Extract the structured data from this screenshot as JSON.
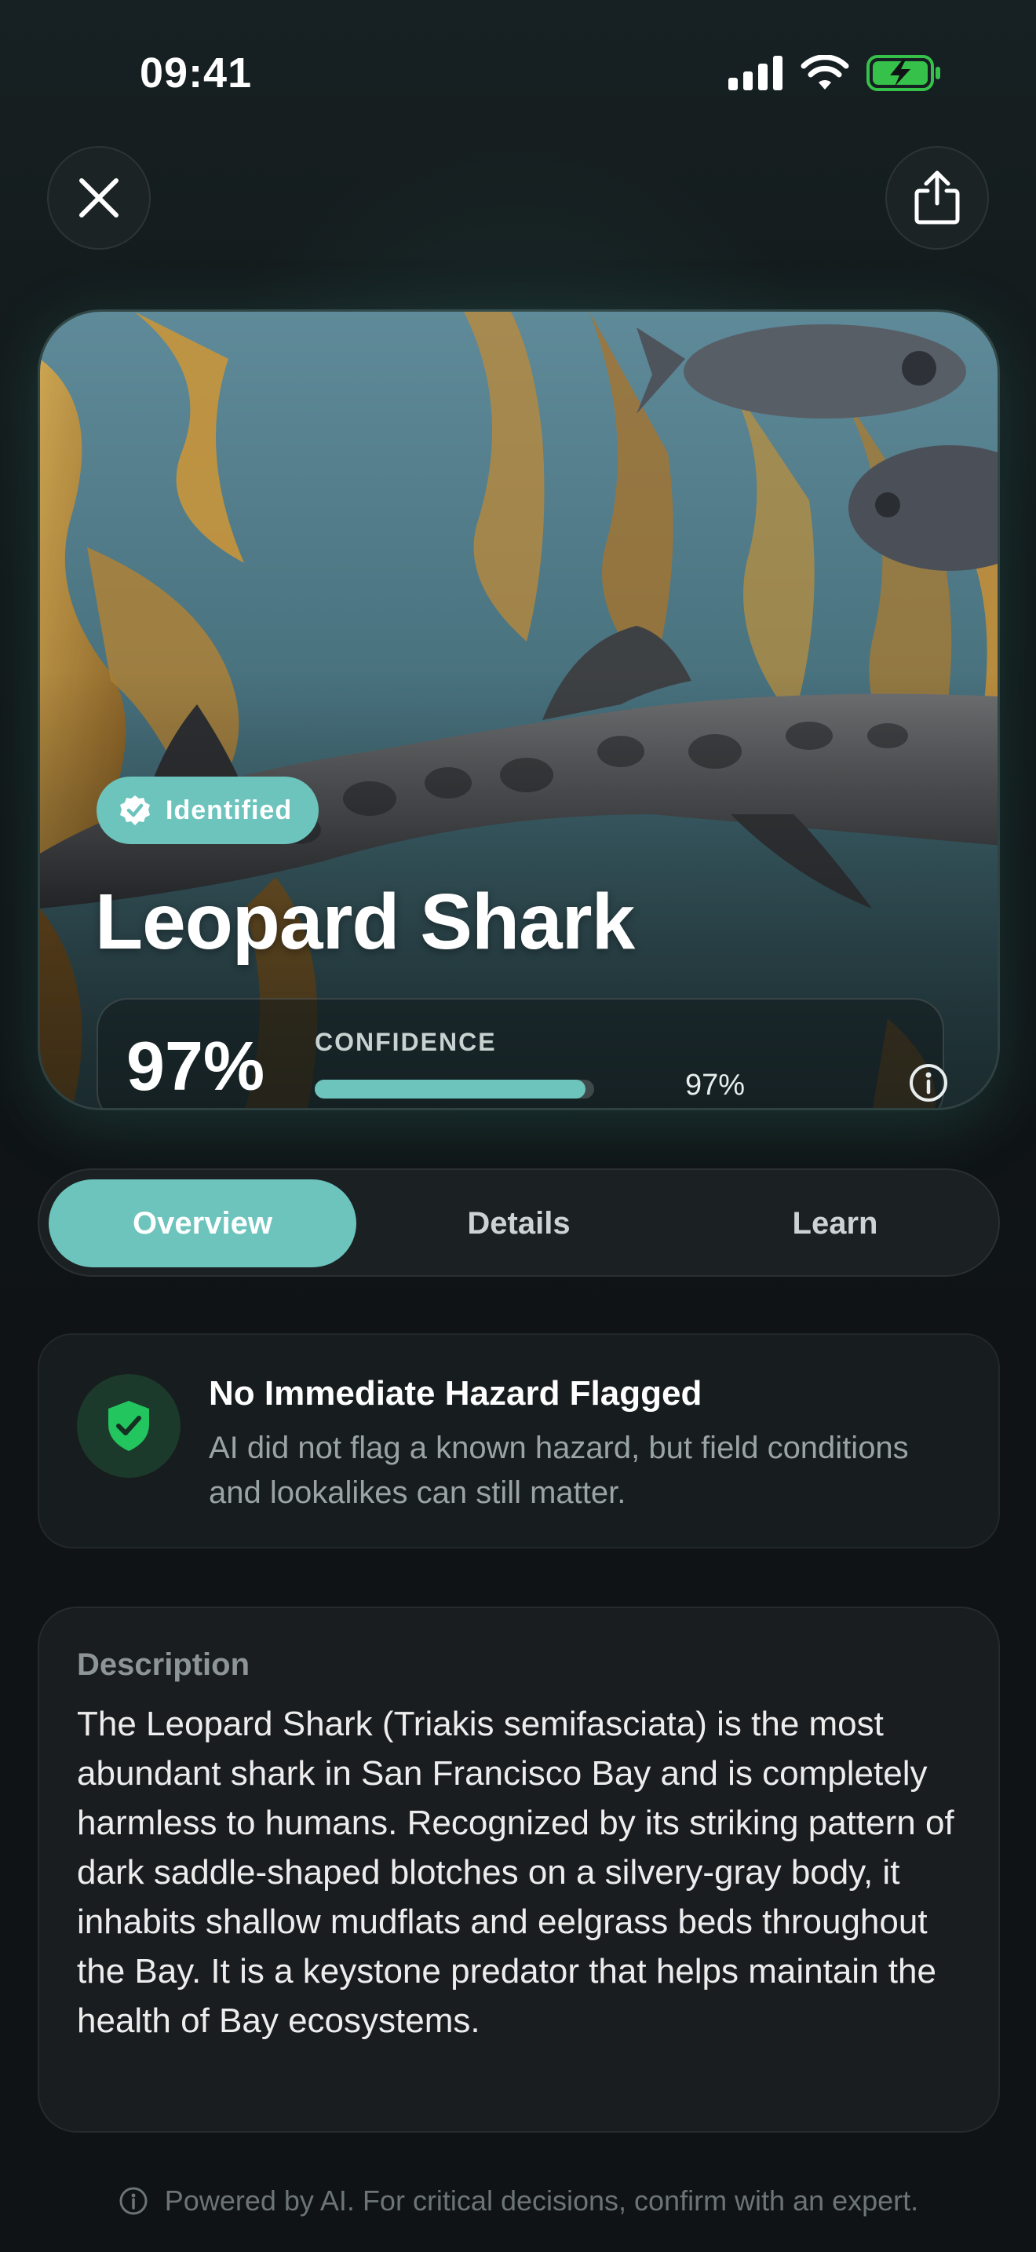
{
  "status_bar": {
    "time": "09:41"
  },
  "hero": {
    "badge": "Identified",
    "title": "Leopard Shark",
    "confidence_display": "97%",
    "confidence_label": "CONFIDENCE",
    "confidence_small": "97%",
    "confidence_value": 0.97
  },
  "tabs": [
    {
      "label": "Overview",
      "active": true
    },
    {
      "label": "Details",
      "active": false
    },
    {
      "label": "Learn",
      "active": false
    }
  ],
  "hazard": {
    "title": "No Immediate Hazard Flagged",
    "text": "AI did not flag a known hazard, but field conditions and lookalikes can still matter."
  },
  "description": {
    "title": "Description",
    "body": "The Leopard Shark (Triakis semifasciata) is the most abundant shark in San Francisco Bay and is completely harmless to humans. Recognized by its striking pattern of dark saddle-shaped blotches on a silvery-gray body, it inhabits shallow mudflats and eelgrass beds throughout the Bay. It is a keystone predator that helps maintain the health of Bay ecosystems."
  },
  "footer": {
    "text": "Powered by AI. For critical decisions, confirm with an expert."
  },
  "colors": {
    "accent": "#6cc4bd",
    "safe": "#22c55e",
    "background": "#0f1315"
  }
}
